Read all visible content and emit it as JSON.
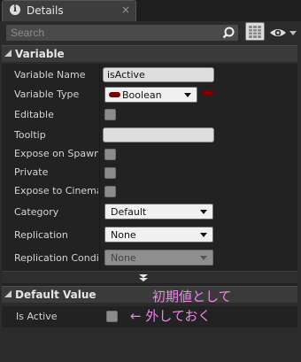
{
  "tab": {
    "icon": "info-icon",
    "icon_glyph": "i",
    "label": "Details",
    "close": "×"
  },
  "search": {
    "placeholder": "Search",
    "icon": "search-icon"
  },
  "toolbar": {
    "grid_icon": "property-matrix-icon",
    "eye_icon": "eye-icon",
    "dropdown_icon": "chevron-down-icon"
  },
  "variable_section": {
    "title": "Variable",
    "rows": [
      {
        "label": "Variable Name",
        "type": "text",
        "value": "isActive"
      },
      {
        "label": "Variable Type",
        "type": "pin-combo",
        "value": "Boolean",
        "pin_color": "#7a0000"
      },
      {
        "label": "Editable",
        "type": "checkbox",
        "checked": false
      },
      {
        "label": "Tooltip",
        "type": "text",
        "value": ""
      },
      {
        "label": "Expose on Spawn",
        "type": "checkbox",
        "checked": false
      },
      {
        "label": "Private",
        "type": "checkbox",
        "checked": false
      },
      {
        "label": "Expose to Cinematics",
        "type": "checkbox",
        "checked": false
      },
      {
        "label": "Category",
        "type": "combo",
        "value": "Default"
      },
      {
        "label": "Replication",
        "type": "combo",
        "value": "None"
      },
      {
        "label": "Replication Condition",
        "type": "combo",
        "value": "None",
        "disabled": true
      }
    ]
  },
  "default_value_section": {
    "title": "Default Value",
    "rows": [
      {
        "label": "Is Active",
        "type": "checkbox",
        "checked": false
      }
    ]
  },
  "annotations": {
    "line1": "初期値として",
    "line2": "← 外しておく",
    "color": "#ea87e8"
  },
  "colors": {
    "panel_bg": "#2b2b2b",
    "row_bg": "#222222",
    "header_bg": "#3a3a3a",
    "pin_boolean": "#7a0000"
  }
}
